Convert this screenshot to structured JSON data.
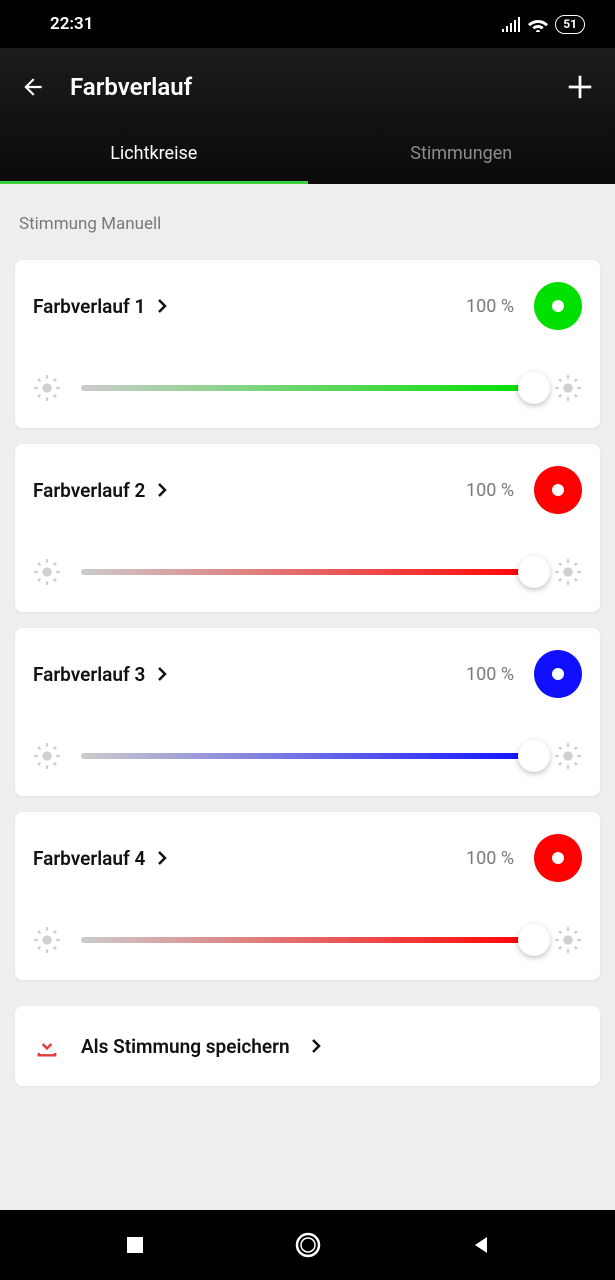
{
  "status": {
    "time": "22:31",
    "battery": "51"
  },
  "header": {
    "title": "Farbverlauf"
  },
  "tabs": {
    "active": "Lichtkreise",
    "inactive": "Stimmungen"
  },
  "section_label": "Stimmung Manuell",
  "items": [
    {
      "title": "Farbverlauf 1",
      "percent": "100 %",
      "color": "#00e000",
      "slider_pct": 100,
      "fill_start": "#cccccc"
    },
    {
      "title": "Farbverlauf 2",
      "percent": "100 %",
      "color": "#ff0000",
      "slider_pct": 100,
      "fill_start": "#cccccc"
    },
    {
      "title": "Farbverlauf 3",
      "percent": "100 %",
      "color": "#1010ff",
      "slider_pct": 100,
      "fill_start": "#cccccc"
    },
    {
      "title": "Farbverlauf 4",
      "percent": "100 %",
      "color": "#ff0000",
      "slider_pct": 100,
      "fill_start": "#cccccc"
    }
  ],
  "save": {
    "label": "Als Stimmung speichern"
  }
}
